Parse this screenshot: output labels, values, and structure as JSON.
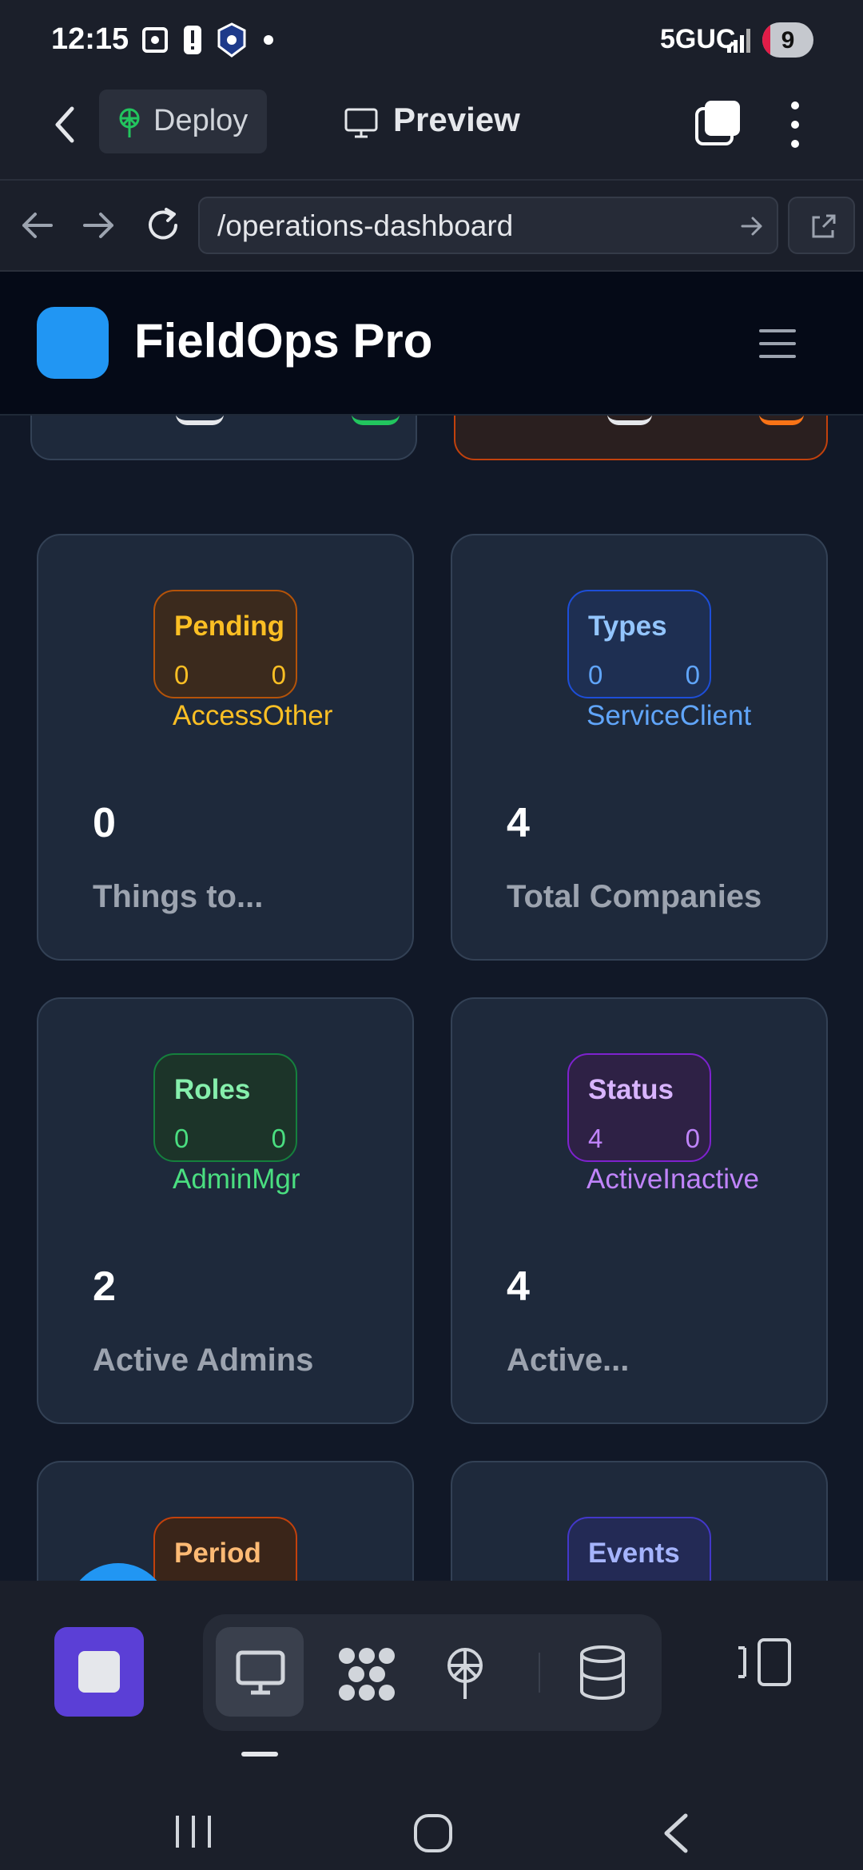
{
  "status_bar": {
    "time": "12:15",
    "network": "5GUC",
    "battery": "9"
  },
  "toolbar": {
    "deploy_label": "Deploy",
    "preview_label": "Preview"
  },
  "address_bar": {
    "url": "/operations-dashboard"
  },
  "app": {
    "title": "FieldOps Pro",
    "logo_color": "#2196f3"
  },
  "cards": [
    {
      "badge_title": "Pending",
      "badge_v1": "0",
      "badge_v2": "0",
      "badge_sub": "AccessOther",
      "value": "0",
      "label": "Things to...",
      "accent": "#fbbf24"
    },
    {
      "badge_title": "Types",
      "badge_v1": "0",
      "badge_v2": "0",
      "badge_sub": "ServiceClient",
      "value": "4",
      "label": "Total Companies",
      "accent": "#60a5fa"
    },
    {
      "badge_title": "Roles",
      "badge_v1": "0",
      "badge_v2": "0",
      "badge_sub": "AdminMgr",
      "value": "2",
      "label": "Active Admins",
      "accent": "#4ade80"
    },
    {
      "badge_title": "Status",
      "badge_v1": "4",
      "badge_v2": "0",
      "badge_sub": "ActiveInactive",
      "value": "4",
      "label": "Active...",
      "accent": "#c084fc"
    },
    {
      "badge_title": "Period",
      "accent": "#fb923c"
    },
    {
      "badge_title": "Events",
      "accent": "#818cf8"
    }
  ],
  "icons": [
    "back-icon",
    "deploy-icon",
    "monitor-icon",
    "tabs-icon",
    "menu-dots-icon",
    "nav-back-icon",
    "nav-forward-icon",
    "reload-icon",
    "go-icon",
    "external-link-icon",
    "hamburger-icon",
    "stop-icon",
    "desktop-icon",
    "apps-icon",
    "deploy-icon",
    "database-icon",
    "devices-icon"
  ],
  "colors": {
    "accent_purple": "#5b3fd6",
    "card_bg": "#1e293b",
    "page_bg": "#111827"
  }
}
